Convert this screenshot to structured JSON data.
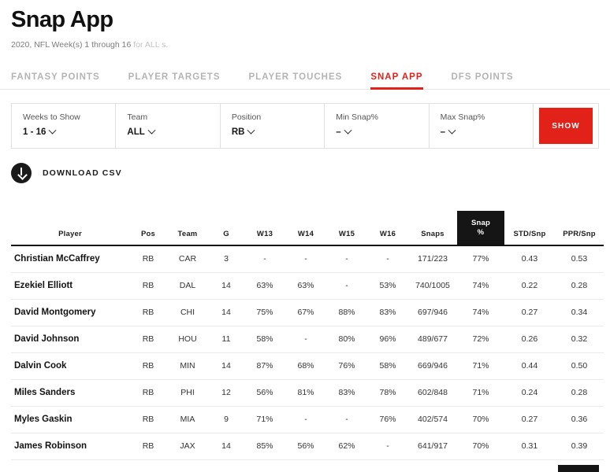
{
  "header": {
    "title": "Snap App",
    "subtitle_strong": "2020, NFL Week(s) 1 through 16",
    "subtitle_faint": "for ALL s."
  },
  "tabs": [
    {
      "label": "FANTASY POINTS",
      "active": false
    },
    {
      "label": "PLAYER TARGETS",
      "active": false
    },
    {
      "label": "PLAYER TOUCHES",
      "active": false
    },
    {
      "label": "SNAP APP",
      "active": true
    },
    {
      "label": "DFS POINTS",
      "active": false
    }
  ],
  "filters": [
    {
      "label": "Weeks to Show",
      "value": "1 - 16"
    },
    {
      "label": "Team",
      "value": "ALL"
    },
    {
      "label": "Position",
      "value": "RB"
    },
    {
      "label": "Min Snap%",
      "value": "–"
    },
    {
      "label": "Max Snap%",
      "value": "–"
    }
  ],
  "show_button": {
    "label": "SHOW"
  },
  "download": {
    "label": "DOWNLOAD CSV",
    "icon": "download-circle-icon"
  },
  "table": {
    "columns": [
      {
        "key": "player",
        "label": "Player"
      },
      {
        "key": "pos",
        "label": "Pos"
      },
      {
        "key": "team",
        "label": "Team"
      },
      {
        "key": "g",
        "label": "G"
      },
      {
        "key": "w13",
        "label": "W13"
      },
      {
        "key": "w14",
        "label": "W14"
      },
      {
        "key": "w15",
        "label": "W15"
      },
      {
        "key": "w16",
        "label": "W16"
      },
      {
        "key": "snaps",
        "label": "Snaps"
      },
      {
        "key": "snap_pct",
        "label": "Snap\n%",
        "active": true
      },
      {
        "key": "std_snp",
        "label": "STD/Snp"
      },
      {
        "key": "ppr_snp",
        "label": "PPR/Snp"
      }
    ],
    "active_sort_column": "Snap %",
    "rows": [
      {
        "player": "Christian McCaffrey",
        "pos": "RB",
        "team": "CAR",
        "g": "3",
        "w13": "-",
        "w14": "-",
        "w15": "-",
        "w16": "-",
        "snaps": "171/223",
        "snap_pct": "77%",
        "std_snp": "0.43",
        "ppr_snp": "0.53"
      },
      {
        "player": "Ezekiel Elliott",
        "pos": "RB",
        "team": "DAL",
        "g": "14",
        "w13": "63%",
        "w14": "63%",
        "w15": "-",
        "w16": "53%",
        "snaps": "740/1005",
        "snap_pct": "74%",
        "std_snp": "0.22",
        "ppr_snp": "0.28"
      },
      {
        "player": "David Montgomery",
        "pos": "RB",
        "team": "CHI",
        "g": "14",
        "w13": "75%",
        "w14": "67%",
        "w15": "88%",
        "w16": "83%",
        "snaps": "697/946",
        "snap_pct": "74%",
        "std_snp": "0.27",
        "ppr_snp": "0.34"
      },
      {
        "player": "David Johnson",
        "pos": "RB",
        "team": "HOU",
        "g": "11",
        "w13": "58%",
        "w14": "-",
        "w15": "80%",
        "w16": "96%",
        "snaps": "489/677",
        "snap_pct": "72%",
        "std_snp": "0.26",
        "ppr_snp": "0.32"
      },
      {
        "player": "Dalvin Cook",
        "pos": "RB",
        "team": "MIN",
        "g": "14",
        "w13": "87%",
        "w14": "68%",
        "w15": "76%",
        "w16": "58%",
        "snaps": "669/946",
        "snap_pct": "71%",
        "std_snp": "0.44",
        "ppr_snp": "0.50"
      },
      {
        "player": "Miles Sanders",
        "pos": "RB",
        "team": "PHI",
        "g": "12",
        "w13": "56%",
        "w14": "81%",
        "w15": "83%",
        "w16": "78%",
        "snaps": "602/848",
        "snap_pct": "71%",
        "std_snp": "0.24",
        "ppr_snp": "0.28"
      },
      {
        "player": "Myles Gaskin",
        "pos": "RB",
        "team": "MIA",
        "g": "9",
        "w13": "71%",
        "w14": "-",
        "w15": "-",
        "w16": "76%",
        "snaps": "402/574",
        "snap_pct": "70%",
        "std_snp": "0.27",
        "ppr_snp": "0.36"
      },
      {
        "player": "James Robinson",
        "pos": "RB",
        "team": "JAX",
        "g": "14",
        "w13": "85%",
        "w14": "56%",
        "w15": "62%",
        "w16": "-",
        "snaps": "641/917",
        "snap_pct": "70%",
        "std_snp": "0.31",
        "ppr_snp": "0.39"
      }
    ]
  },
  "colors": {
    "accent_red": "#e22219",
    "header_black": "#151515",
    "text_dark": "#1a1a1a",
    "muted": "#b4b4b4"
  }
}
